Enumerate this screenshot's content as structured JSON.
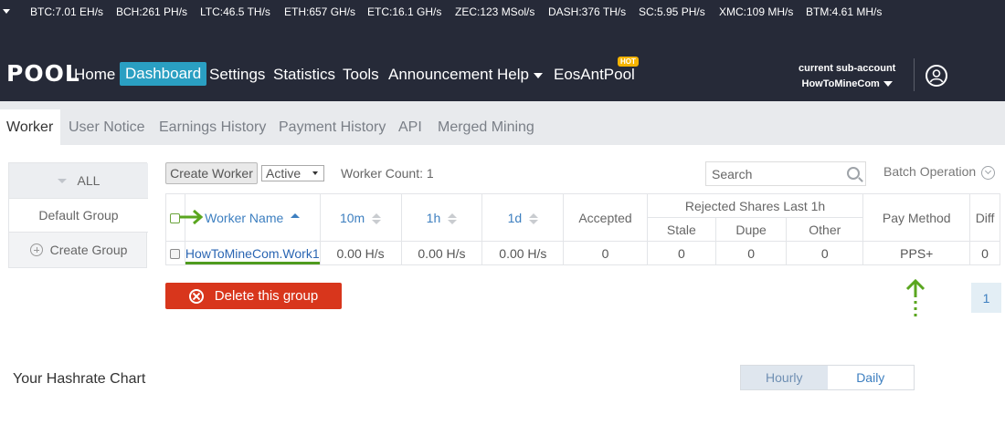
{
  "ticker": [
    {
      "coin": "BTC",
      "value": "7.01 EH/s"
    },
    {
      "coin": "BCH",
      "value": "261 PH/s"
    },
    {
      "coin": "LTC",
      "value": "46.5 TH/s"
    },
    {
      "coin": "ETH",
      "value": "657 GH/s"
    },
    {
      "coin": "ETC",
      "value": "16.1 GH/s"
    },
    {
      "coin": "ZEC",
      "value": "123 MSol/s"
    },
    {
      "coin": "DASH",
      "value": "376 TH/s"
    },
    {
      "coin": "SC",
      "value": "5.95 PH/s"
    },
    {
      "coin": "XMC",
      "value": "109 MH/s"
    },
    {
      "coin": "BTM",
      "value": "4.61 MH/s"
    }
  ],
  "ticker_labels": [
    "BTC:7.01 EH/s",
    "BCH:261 PH/s",
    "LTC:46.5 TH/s",
    "ETH:657 GH/s",
    "ETC:16.1 GH/s",
    "ZEC:123 MSol/s",
    "DASH:376 TH/s",
    "SC:5.95 PH/s",
    "XMC:109 MH/s",
    "BTM:4.61 MH/s"
  ],
  "logo": "POOL",
  "nav": {
    "home": "Home",
    "dashboard": "Dashboard",
    "settings": "Settings",
    "statistics": "Statistics",
    "tools": "Tools",
    "announcement": "Announcement",
    "help": "Help",
    "eosantpool": "EosAntPool",
    "hot_badge": "HOT"
  },
  "subaccount": {
    "label": "current sub-account",
    "name": "HowToMineCom"
  },
  "tabs": [
    "Worker",
    "User Notice",
    "Earnings History",
    "Payment History",
    "API",
    "Merged Mining"
  ],
  "groups": {
    "all": "ALL",
    "default": "Default Group",
    "create": "Create Group"
  },
  "toolbar": {
    "create_worker": "Create Worker",
    "status_select": "Active",
    "worker_count": "Worker Count: 1",
    "search_placeholder": "Search",
    "batch_operation": "Batch Operation"
  },
  "table": {
    "headers": {
      "worker_name": "Worker Name",
      "m10": "10m",
      "h1": "1h",
      "d1": "1d",
      "accepted": "Accepted",
      "rejected_group": "Rejected Shares Last 1h",
      "stale": "Stale",
      "dupe": "Dupe",
      "other": "Other",
      "pay_method": "Pay Method",
      "diff": "Diff"
    },
    "rows": [
      {
        "worker_name": "HowToMineCom.Work1",
        "m10": "0.00 H/s",
        "h1": "0.00 H/s",
        "d1": "0.00 H/s",
        "accepted": "0",
        "stale": "0",
        "dupe": "0",
        "other": "0",
        "pay_method": "PPS+",
        "diff": "0"
      }
    ]
  },
  "delete_group": "Delete this group",
  "pagination": {
    "current": "1"
  },
  "chart": {
    "title": "Your Hashrate Chart",
    "hourly": "Hourly",
    "daily": "Daily"
  },
  "colors": {
    "topbar": "#262a38",
    "accent": "#2a9fc2",
    "link": "#3d7fc0",
    "danger": "#d8361c",
    "annotation_green": "#5aa61f",
    "hot": "#f6b400"
  }
}
